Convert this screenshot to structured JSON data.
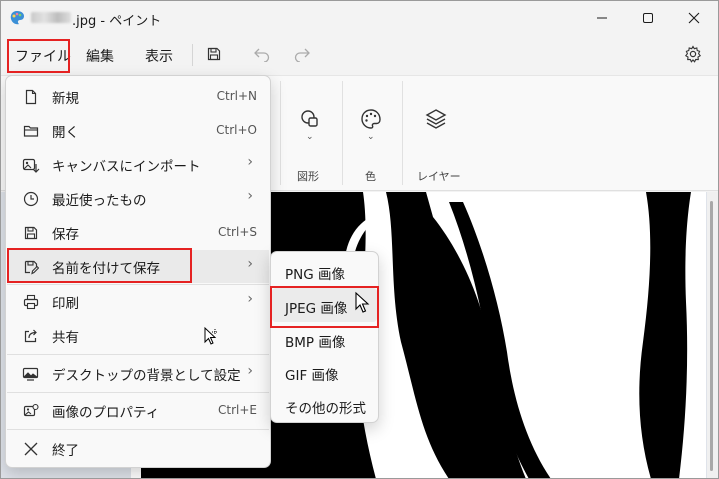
{
  "window": {
    "title_suffix": ".jpg - ペイント"
  },
  "menubar": {
    "file": "ファイル",
    "edit": "編集",
    "view": "表示"
  },
  "ribbon": {
    "shapes_label": "図形",
    "colors_label": "色",
    "layers_label": "レイヤー"
  },
  "file_menu": {
    "items": [
      {
        "label": "新規",
        "shortcut": "Ctrl+N",
        "icon": "new-file-icon"
      },
      {
        "label": "開く",
        "shortcut": "Ctrl+O",
        "icon": "folder-icon"
      },
      {
        "label": "キャンバスにインポート",
        "shortcut": "",
        "icon": "import-icon",
        "submenu": true
      },
      {
        "label": "最近使ったもの",
        "shortcut": "",
        "icon": "clock-icon",
        "submenu": true
      },
      {
        "label": "保存",
        "shortcut": "Ctrl+S",
        "icon": "save-icon"
      },
      {
        "label": "名前を付けて保存",
        "shortcut": "",
        "icon": "save-as-icon",
        "submenu": true
      },
      {
        "label": "印刷",
        "shortcut": "",
        "icon": "printer-icon",
        "submenu": true
      },
      {
        "label": "共有",
        "shortcut": "",
        "icon": "share-icon"
      },
      {
        "label": "デスクトップの背景として設定",
        "shortcut": "",
        "icon": "desktop-background-icon",
        "submenu": true
      },
      {
        "label": "画像のプロパティ",
        "shortcut": "Ctrl+E",
        "icon": "image-properties-icon"
      },
      {
        "label": "終了",
        "shortcut": "",
        "icon": "close-icon"
      }
    ]
  },
  "save_as_submenu": {
    "items": [
      "PNG 画像",
      "JPEG 画像",
      "BMP 画像",
      "GIF 画像",
      "その他の形式"
    ]
  },
  "colors": {
    "highlight": "#e52222",
    "menu_bg": "#f9f9f9"
  }
}
